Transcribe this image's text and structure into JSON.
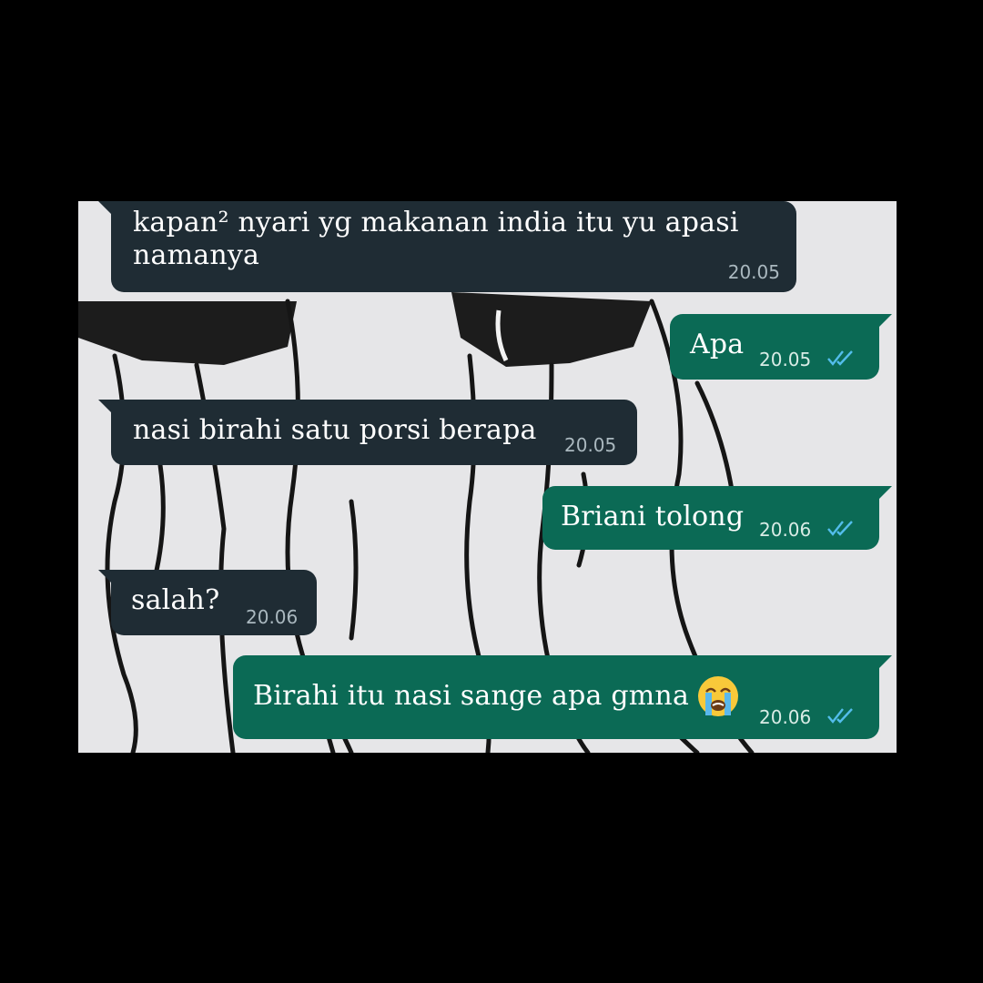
{
  "messages": [
    {
      "direction": "incoming",
      "text": "kapan² nyari yg makanan india itu yu apasi\nnamanya",
      "time": "20.05"
    },
    {
      "direction": "outgoing",
      "text": "Apa",
      "time": "20.05",
      "status": "read-double-check-icon"
    },
    {
      "direction": "incoming",
      "text": "nasi birahi satu porsi berapa",
      "time": "20.05"
    },
    {
      "direction": "outgoing",
      "text": "Briani tolong",
      "time": "20.06",
      "status": "read-double-check-icon"
    },
    {
      "direction": "incoming",
      "text": "salah?",
      "time": "20.06"
    },
    {
      "direction": "outgoing",
      "text": "Birahi itu nasi sange apa gmna",
      "emoji": "loudly-crying-face-icon",
      "time": "20.06",
      "status": "read-double-check-icon"
    }
  ],
  "colors": {
    "incoming_bubble": "#1f2c34",
    "outgoing_bubble": "#0b6a55",
    "read_ticks": "#53bdeb",
    "chat_background": "#e6e6e8"
  }
}
